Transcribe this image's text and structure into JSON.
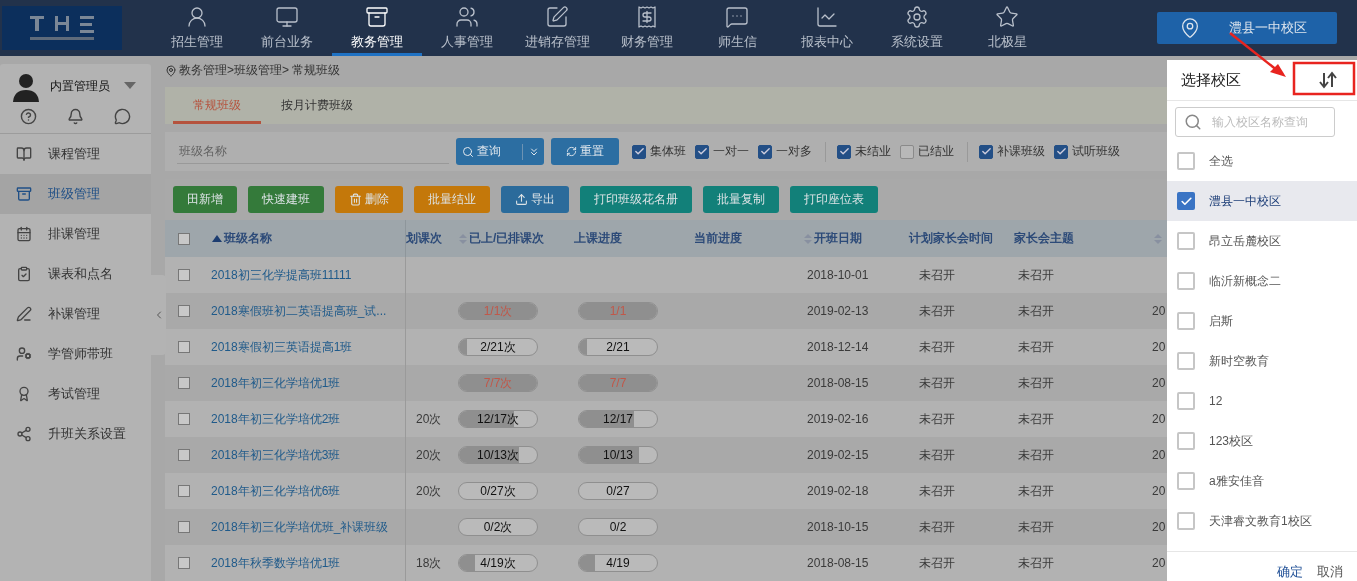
{
  "nav": {
    "items": [
      {
        "label": "招生管理",
        "selected": false
      },
      {
        "label": "前台业务",
        "selected": false
      },
      {
        "label": "教务管理",
        "selected": true
      },
      {
        "label": "人事管理",
        "selected": false
      },
      {
        "label": "进销存管理",
        "selected": false
      },
      {
        "label": "财务管理",
        "selected": false
      },
      {
        "label": "师生信",
        "selected": false
      },
      {
        "label": "报表中心",
        "selected": false
      },
      {
        "label": "系统设置",
        "selected": false
      },
      {
        "label": "北极星",
        "selected": false
      }
    ],
    "campus_button": "澧县一中校区"
  },
  "user": {
    "name": "内置管理员"
  },
  "sidebar": {
    "items": [
      {
        "label": "课程管理",
        "selected": false
      },
      {
        "label": "班级管理",
        "selected": true
      },
      {
        "label": "排课管理",
        "selected": false
      },
      {
        "label": "课表和点名",
        "selected": false
      },
      {
        "label": "补课管理",
        "selected": false
      },
      {
        "label": "学管师带班",
        "selected": false
      },
      {
        "label": "考试管理",
        "selected": false
      },
      {
        "label": "升班关系设置",
        "selected": false
      }
    ]
  },
  "breadcrumb": "教务管理>班级管理> 常规班级",
  "tabs": [
    {
      "label": "常规班级",
      "selected": true
    },
    {
      "label": "按月计费班级",
      "selected": false
    }
  ],
  "filters": {
    "search_placeholder": "班级名称",
    "query_button": "查询",
    "reset_button": "重置",
    "groups": [
      [
        {
          "label": "集体班",
          "checked": true
        },
        {
          "label": "一对一",
          "checked": true
        },
        {
          "label": "一对多",
          "checked": true
        }
      ],
      [
        {
          "label": "未结业",
          "checked": true
        },
        {
          "label": "已结业",
          "checked": false
        }
      ],
      [
        {
          "label": "补课班级",
          "checked": true
        },
        {
          "label": "试听班级",
          "checked": true
        }
      ]
    ]
  },
  "actions": [
    {
      "label": "田新增",
      "color": "#347a3a"
    },
    {
      "label": "快速建班",
      "color": "#347a3a"
    },
    {
      "label": "删除",
      "color": "#c4780a"
    },
    {
      "label": "批量结业",
      "color": "#c4780a"
    },
    {
      "label": "导出",
      "color": "#2b6b9b"
    },
    {
      "label": "打印班级花名册",
      "color": "#128079"
    },
    {
      "label": "批量复制",
      "color": "#128079"
    },
    {
      "label": "打印座位表",
      "color": "#128079"
    }
  ],
  "table": {
    "select_all_checked": false,
    "columns": [
      {
        "label": "班级名称",
        "sorted_ascending": true
      },
      {
        "label": "划课次"
      },
      {
        "label": "已上/已排课次",
        "sorted_ascending": false
      },
      {
        "label": "上课进度"
      },
      {
        "label": "当前进度"
      },
      {
        "label": "开班日期",
        "sorted_ascending": false
      },
      {
        "label": "计划家长会时间"
      },
      {
        "label": "家长会主题"
      },
      {
        "sorted_ascending": false
      }
    ],
    "rows": [
      {
        "checked": false,
        "name": "2018初三化学提高班11111",
        "planned": null,
        "done": null,
        "progress": null,
        "start_date": "2018-10-01",
        "meeting_time": "未召开",
        "meeting_topic": "未召开",
        "column_9": null
      },
      {
        "checked": false,
        "name": "2018寒假班初二英语提高班_试...",
        "planned": null,
        "done": {
          "text": "1/1次",
          "level": 1
        },
        "progress": {
          "text": "1/1",
          "level": 1
        },
        "start_date": "2019-02-13",
        "meeting_time": "未召开",
        "meeting_topic": "未召开",
        "column_9": "20"
      },
      {
        "checked": false,
        "name": "2018寒假初三英语提高1班",
        "planned": null,
        "done": {
          "text": "2/21次",
          "level": 0.1
        },
        "progress": {
          "text": "2/21",
          "level": 0.1
        },
        "start_date": "2018-12-14",
        "meeting_time": "未召开",
        "meeting_topic": "未召开",
        "column_9": "20"
      },
      {
        "checked": false,
        "name": "2018年初三化学培优1班",
        "planned": null,
        "done": {
          "text": "7/7次",
          "level": 1
        },
        "progress": {
          "text": "7/7",
          "level": 1
        },
        "start_date": "2018-08-15",
        "meeting_time": "未召开",
        "meeting_topic": "未召开",
        "column_9": "20"
      },
      {
        "checked": false,
        "name": "2018年初三化学培优2班",
        "planned": "20次",
        "done": {
          "text": "12/17次",
          "level": 0.71
        },
        "progress": {
          "text": "12/17",
          "level": 0.71
        },
        "start_date": "2019-02-16",
        "meeting_time": "未召开",
        "meeting_topic": "未召开",
        "column_9": "20"
      },
      {
        "checked": false,
        "name": "2018年初三化学培优3班",
        "planned": "20次",
        "done": {
          "text": "10/13次",
          "level": 0.77
        },
        "progress": {
          "text": "10/13",
          "level": 0.77
        },
        "start_date": "2019-02-15",
        "meeting_time": "未召开",
        "meeting_topic": "未召开",
        "column_9": "20"
      },
      {
        "checked": false,
        "name": "2018年初三化学培优6班",
        "planned": "20次",
        "done": {
          "text": "0/27次",
          "level": 0
        },
        "progress": {
          "text": "0/27",
          "level": 0
        },
        "start_date": "2019-02-18",
        "meeting_time": "未召开",
        "meeting_topic": "未召开",
        "column_9": "20"
      },
      {
        "checked": false,
        "name": "2018年初三化学培优班_补课班级",
        "planned": null,
        "done": {
          "text": "0/2次",
          "level": 0
        },
        "progress": {
          "text": "0/2",
          "level": 0
        },
        "start_date": "2018-10-15",
        "meeting_time": "未召开",
        "meeting_topic": "未召开",
        "column_9": "20"
      },
      {
        "checked": false,
        "name": "2018年秋季数学培优1班",
        "planned": "18次",
        "done": {
          "text": "4/19次",
          "level": 0.21
        },
        "progress": {
          "text": "4/19",
          "level": 0.21
        },
        "start_date": "2018-08-15",
        "meeting_time": "未召开",
        "meeting_topic": "未召开",
        "column_9": "20"
      }
    ]
  },
  "panel": {
    "title": "选择校区",
    "search_placeholder": "输入校区名称查询",
    "items": [
      {
        "label": "全选",
        "checked": false,
        "selected": false
      },
      {
        "label": "澧县一中校区",
        "checked": true,
        "selected": true
      },
      {
        "label": "昂立岳麓校区",
        "checked": false,
        "selected": false
      },
      {
        "label": "临沂新概念二",
        "checked": false,
        "selected": false
      },
      {
        "label": "启斯",
        "checked": false,
        "selected": false
      },
      {
        "label": "新时空教育",
        "checked": false,
        "selected": false
      },
      {
        "label": "12",
        "checked": false,
        "selected": false
      },
      {
        "label": "123校区",
        "checked": false,
        "selected": false
      },
      {
        "label": "a雅安佳音",
        "checked": false,
        "selected": false
      },
      {
        "label": "天津睿文教育1校区",
        "checked": false,
        "selected": false
      }
    ],
    "confirm": "确定",
    "cancel": "取消"
  }
}
